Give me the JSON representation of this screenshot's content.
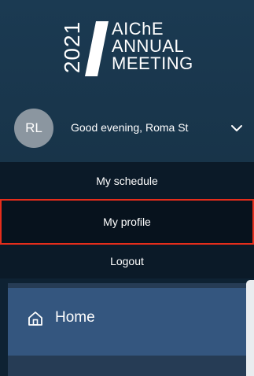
{
  "logo": {
    "year": "2021",
    "line1": "AIChE",
    "line2": "ANNUAL",
    "line3": "MEETING"
  },
  "user": {
    "initials": "RL",
    "greeting": "Good evening, Roma St"
  },
  "menu": {
    "items": [
      {
        "label": "My schedule"
      },
      {
        "label": "My profile",
        "selected": true
      },
      {
        "label": "Logout"
      }
    ]
  },
  "nav": {
    "home_label": "Home"
  },
  "colors": {
    "header_bg": "#1b3a52",
    "menu_bg": "#0b1a28",
    "highlight_border": "#e52d1b",
    "nav_active_bg": "#34567f"
  }
}
